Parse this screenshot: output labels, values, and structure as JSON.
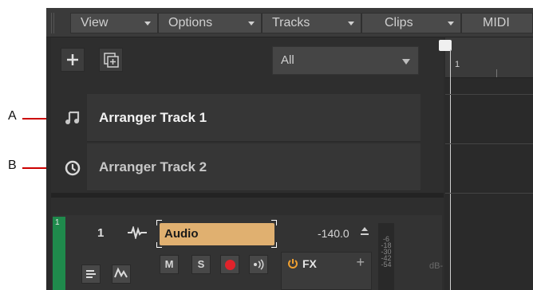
{
  "callouts": {
    "a": "A",
    "b": "B"
  },
  "menubar": {
    "items": [
      {
        "label": "View"
      },
      {
        "label": "Options"
      },
      {
        "label": "Tracks"
      },
      {
        "label": "Clips"
      },
      {
        "label": "MIDI"
      }
    ]
  },
  "toolbar": {
    "add_icon": "plus-icon",
    "duplicate_icon": "add-track-icon",
    "filter": {
      "value": "All"
    }
  },
  "timeline": {
    "marker": "1"
  },
  "arranger_tracks": [
    {
      "name": "Arranger Track 1",
      "icon": "music-note-icon",
      "text_color": "#f2f2f2"
    },
    {
      "name": "Arranger Track 2",
      "icon": "clock-icon",
      "text_color": "#c8c8c8"
    }
  ],
  "audio_track": {
    "number": "1",
    "strip_number": "1",
    "name": "Audio",
    "volume": "-140.0",
    "mute": "M",
    "solo": "S",
    "fx_label": "FX",
    "fx_add": "+",
    "meter_scale": [
      "-6",
      "-18",
      "-30",
      "-42",
      "-54"
    ],
    "db_label": "dB-"
  },
  "colors": {
    "accent_audio": "#e0b070",
    "track_strip": "#1f8a4c",
    "record": "#e0232b",
    "callout": "#cc0000"
  }
}
